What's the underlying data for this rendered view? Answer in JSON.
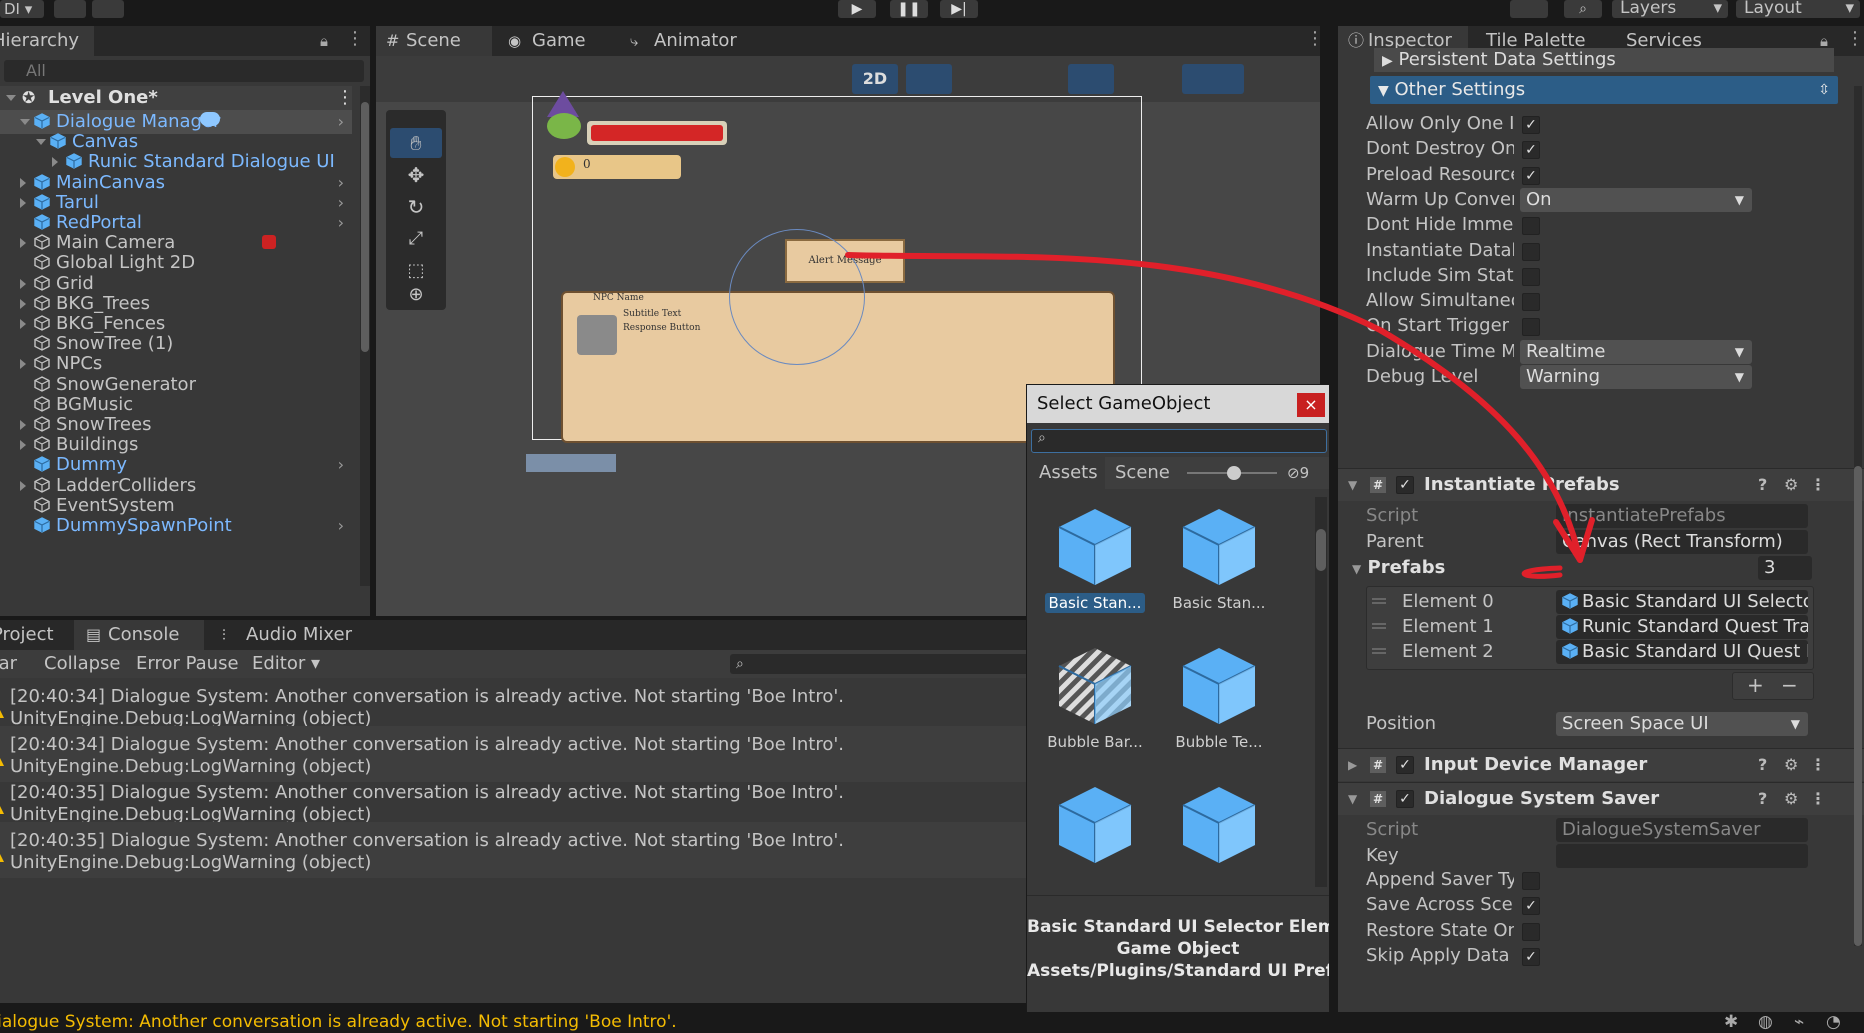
{
  "toolbar": {
    "account_label": "DI",
    "layers_label": "Layers",
    "layout_label": "Layout"
  },
  "hierarchy": {
    "tab_label": "Hierarchy",
    "search_placeholder": "All",
    "scene_name": "Level One*",
    "items": [
      {
        "label": "Dialogue Manager",
        "blue": true
      },
      {
        "label": "Canvas",
        "blue": true
      },
      {
        "label": "Runic Standard Dialogue UI",
        "blue": true
      },
      {
        "label": "MainCanvas",
        "blue": true
      },
      {
        "label": "Tarul",
        "blue": true
      },
      {
        "label": "RedPortal",
        "blue": true
      },
      {
        "label": "Main Camera",
        "blue": false
      },
      {
        "label": "Global Light 2D",
        "blue": false
      },
      {
        "label": "Grid",
        "blue": false
      },
      {
        "label": "BKG_Trees",
        "blue": false
      },
      {
        "label": "BKG_Fences",
        "blue": false
      },
      {
        "label": "SnowTree (1)",
        "blue": false
      },
      {
        "label": "NPCs",
        "blue": false
      },
      {
        "label": "SnowGenerator",
        "blue": false
      },
      {
        "label": "BGMusic",
        "blue": false
      },
      {
        "label": "SnowTrees",
        "blue": false
      },
      {
        "label": "Buildings",
        "blue": false
      },
      {
        "label": "Dummy",
        "blue": true
      },
      {
        "label": "LadderColliders",
        "blue": false
      },
      {
        "label": "EventSystem",
        "blue": false
      },
      {
        "label": "DummySpawnPoint",
        "blue": true
      }
    ]
  },
  "scene": {
    "tabs": [
      "Scene",
      "Game",
      "Animator"
    ],
    "mode_2d": "2D",
    "canvas_texts": {
      "alert": "Alert Message",
      "npc_name": "NPC Name",
      "subtitle": "Subtitle Text",
      "response": "Response Button",
      "coin_value": "0"
    }
  },
  "console": {
    "tabs": [
      "Project",
      "Console",
      "Audio Mixer"
    ],
    "buttons": [
      "Clear",
      "Collapse",
      "Error Pause",
      "Editor"
    ],
    "logs": [
      {
        "line1": "[20:40:34] Dialogue System: Another conversation is already active. Not starting 'Boe Intro'.",
        "line2": "UnityEngine.Debug:LogWarning (object)"
      },
      {
        "line1": "[20:40:34] Dialogue System: Another conversation is already active. Not starting 'Boe Intro'.",
        "line2": "UnityEngine.Debug:LogWarning (object)"
      },
      {
        "line1": "[20:40:35] Dialogue System: Another conversation is already active. Not starting 'Boe Intro'.",
        "line2": "UnityEngine.Debug:LogWarning (object)"
      },
      {
        "line1": "[20:40:35] Dialogue System: Another conversation is already active. Not starting 'Boe Intro'.",
        "line2": "UnityEngine.Debug:LogWarning (object)"
      }
    ],
    "status_text": "Dialogue System: Another conversation is already active. Not starting 'Boe Intro'."
  },
  "dialog": {
    "title": "Select GameObject",
    "close": "×",
    "tab_assets": "Assets",
    "tab_scene": "Scene",
    "hidden_count": "9",
    "assets": [
      {
        "label": "Basic Stan...",
        "selected": true,
        "striped": false
      },
      {
        "label": "Basic Stan...",
        "selected": false,
        "striped": false
      },
      {
        "label": "Bubble Bar...",
        "selected": false,
        "striped": true
      },
      {
        "label": "Bubble Te...",
        "selected": false,
        "striped": false
      },
      {
        "label": "",
        "selected": false,
        "striped": false
      },
      {
        "label": "",
        "selected": false,
        "striped": false
      }
    ],
    "info_name": "Basic Standard UI Selector Element",
    "info_type": "Game Object",
    "info_path": "Assets/Plugins/Standard UI Prefabs/Templates"
  },
  "inspector": {
    "tabs": [
      "Inspector",
      "Tile Palette",
      "Services"
    ],
    "persistent_header": "Persistent Data Settings",
    "other_settings_header": "Other Settings",
    "other_settings": [
      {
        "label": "Allow Only One Instance",
        "type": "check",
        "checked": true
      },
      {
        "label": "Dont Destroy On Load",
        "type": "check",
        "checked": true
      },
      {
        "label": "Preload Resources",
        "type": "check",
        "checked": true
      },
      {
        "label": "Warm Up Conversations",
        "type": "dropdown",
        "value": "On"
      },
      {
        "label": "Dont Hide Immediate",
        "type": "check",
        "checked": false
      },
      {
        "label": "Instantiate Database",
        "type": "check",
        "checked": false
      },
      {
        "label": "Include Sim Status",
        "type": "check",
        "checked": false
      },
      {
        "label": "Allow Simultaneous",
        "type": "check",
        "checked": false
      },
      {
        "label": "On Start Trigger Wait",
        "type": "check",
        "checked": false
      },
      {
        "label": "Dialogue Time Mode",
        "type": "dropdown",
        "value": "Realtime"
      },
      {
        "label": "Debug Level",
        "type": "dropdown",
        "value": "Warning"
      }
    ],
    "instantiate_prefabs": {
      "title": "Instantiate Prefabs",
      "script_label": "Script",
      "script_value": "InstantiatePrefabs",
      "parent_label": "Parent",
      "parent_value": "Canvas (Rect Transform)",
      "prefabs_label": "Prefabs",
      "prefabs_count": "3",
      "elements": [
        {
          "label": "Element 0",
          "value": "Basic Standard UI Selector"
        },
        {
          "label": "Element 1",
          "value": "Runic Standard Quest Trac"
        },
        {
          "label": "Element 2",
          "value": "Basic Standard UI Quest Lo"
        }
      ],
      "add": "+",
      "remove": "−",
      "position_label": "Position",
      "position_value": "Screen Space UI"
    },
    "input_device_manager": "Input Device Manager",
    "saver": {
      "title": "Dialogue System Saver",
      "script_label": "Script",
      "script_value": "DialogueSystemSaver",
      "key_label": "Key",
      "fields": [
        {
          "label": "Append Saver Type",
          "checked": false
        },
        {
          "label": "Save Across Scene Changes",
          "checked": true
        },
        {
          "label": "Restore State On Start",
          "checked": false
        },
        {
          "label": "Skip Apply Data After",
          "checked": true
        }
      ]
    }
  },
  "colors": {
    "accent": "#2c5d87",
    "selection_blue": "#7cb9ff",
    "arrow_red": "#e0202a",
    "warning": "#f4bc02"
  }
}
